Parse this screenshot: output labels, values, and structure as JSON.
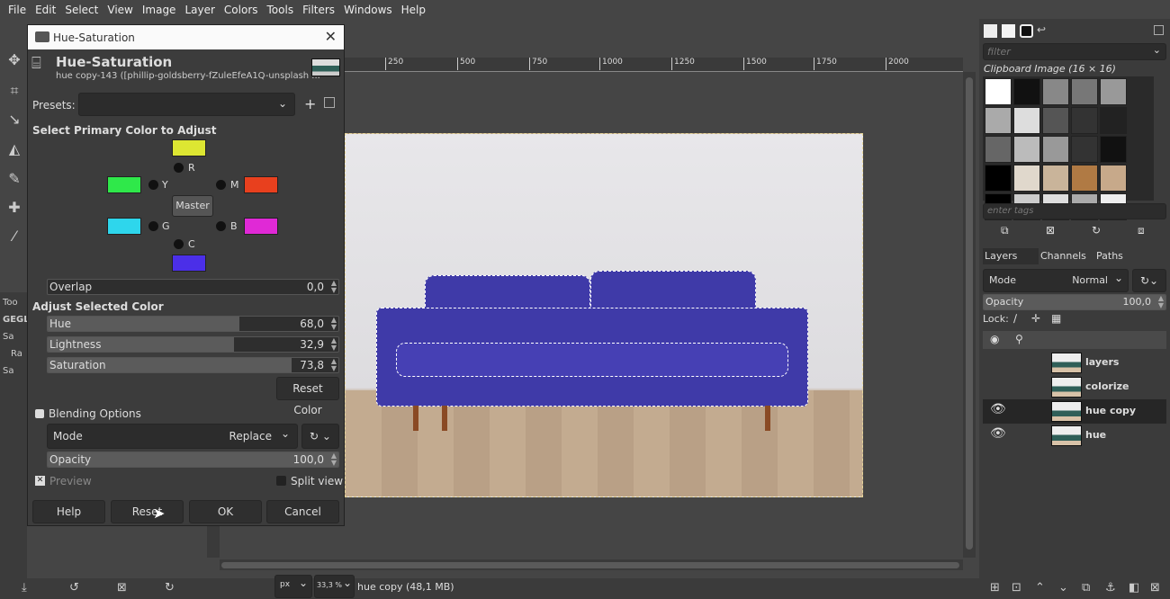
{
  "menu": [
    "File",
    "Edit",
    "Select",
    "View",
    "Image",
    "Layer",
    "Colors",
    "Tools",
    "Filters",
    "Windows",
    "Help"
  ],
  "dialog": {
    "window_title": "Hue-Saturation",
    "heading": "Hue-Saturation",
    "subtitle": "hue copy-143 ([phillip-goldsberry-fZuleEfeA1Q-unsplash ...",
    "presets_label": "Presets:",
    "presets_value": "",
    "select_primary": "Select Primary Color to Adjust",
    "colors": [
      {
        "label": "R",
        "hex": "#dde632"
      },
      {
        "label": "Y",
        "hex": "#2fe84a"
      },
      {
        "label": "M",
        "hex": "#e8401e"
      },
      {
        "label": "G",
        "hex": "#2ed6ec"
      },
      {
        "label": "B",
        "hex": "#e029d6"
      },
      {
        "label": "C",
        "hex": "#4b2fe8"
      }
    ],
    "master": "Master",
    "overlap": {
      "label": "Overlap",
      "value": "0,0",
      "fraction": 0
    },
    "adjust_selected": "Adjust Selected Color",
    "hue": {
      "label": "Hue",
      "value": "68,0",
      "fraction": 0.66
    },
    "lightness": {
      "label": "Lightness",
      "value": "32,9",
      "fraction": 0.64
    },
    "saturation": {
      "label": "Saturation",
      "value": "73,8",
      "fraction": 0.84
    },
    "reset_color": "Reset Color",
    "blending_options": "Blending Options",
    "mode_label": "Mode",
    "mode_value": "Replace",
    "opacity": {
      "label": "Opacity",
      "value": "100,0",
      "fraction": 1
    },
    "preview": "Preview",
    "preview_checked": true,
    "split_view": "Split view",
    "split_checked": false,
    "buttons": {
      "help": "Help",
      "reset": "Reset",
      "ok": "OK",
      "cancel": "Cancel"
    }
  },
  "ruler": [
    "250",
    "500",
    "750",
    "1000",
    "1250",
    "1500",
    "1750",
    "2000"
  ],
  "left_dock": {
    "tab": "Too",
    "gegl": "GEGL",
    "item1": "Sa",
    "item2": "Ra",
    "item3": "Sa"
  },
  "status": {
    "unit": "px",
    "zoom": "33,3 %",
    "info": "hue copy (48,1 MB)"
  },
  "right": {
    "filter_placeholder": "filter",
    "pattern_name": "Clipboard Image (16 × 16)",
    "tags_placeholder": "enter tags",
    "tabs": [
      "Layers",
      "Channels",
      "Paths"
    ],
    "mode_label": "Mode",
    "mode_value": "Normal",
    "opacity_label": "Opacity",
    "opacity_value": "100,0",
    "lock_label": "Lock:",
    "layers": [
      {
        "name": "layers",
        "visible": false
      },
      {
        "name": "colorize",
        "visible": false
      },
      {
        "name": "hue copy",
        "visible": true,
        "selected": true
      },
      {
        "name": "hue",
        "visible": true
      }
    ]
  }
}
